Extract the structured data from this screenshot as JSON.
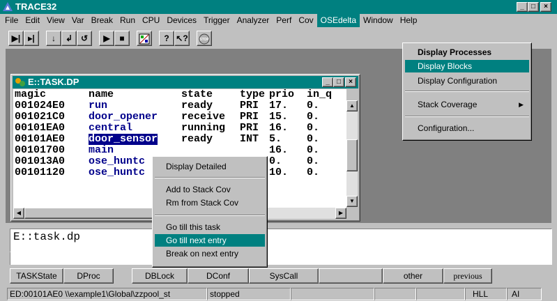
{
  "app": {
    "title": "TRACE32"
  },
  "menubar": [
    "File",
    "Edit",
    "View",
    "Var",
    "Break",
    "Run",
    "CPU",
    "Devices",
    "Trigger",
    "Analyzer",
    "Perf",
    "Cov",
    "OSEdelta",
    "Window",
    "Help"
  ],
  "toolbar_icons": [
    "step-into-icon",
    "step-over-icon",
    "step-down-icon",
    "return-icon",
    "undo-step-icon",
    "go-icon",
    "break-stop-icon",
    "mosaic-icon",
    "help-icon",
    "context-help-icon",
    "stop-icon"
  ],
  "task_window": {
    "title": "E::TASK.DP",
    "headers": {
      "magic": "magic",
      "name": "name",
      "state": "state",
      "type": "type",
      "prio": "prio",
      "inq": "in_q"
    },
    "rows": [
      {
        "magic": "001024E0",
        "name": "run",
        "state": "ready",
        "type": "PRI",
        "prio": "17.",
        "inq": "0."
      },
      {
        "magic": "001021C0",
        "name": "door_opener",
        "state": "receive",
        "type": "PRI",
        "prio": "15.",
        "inq": "0."
      },
      {
        "magic": "00101EA0",
        "name": "central",
        "state": "running",
        "type": "PRI",
        "prio": "16.",
        "inq": "0."
      },
      {
        "magic": "00101AE0",
        "name": "door_sensor",
        "state": "ready",
        "type": "INT",
        "prio": "5.",
        "inq": "0."
      },
      {
        "magic": "00101700",
        "name": "main",
        "state": "",
        "type": "",
        "prio": "16.",
        "inq": "0."
      },
      {
        "magic": "001013A0",
        "name": "ose_huntc",
        "state": "",
        "type": "",
        "prio": "0.",
        "inq": "0."
      },
      {
        "magic": "00101120",
        "name": "ose_huntc",
        "state": "",
        "type": "",
        "prio": "10.",
        "inq": "0."
      }
    ]
  },
  "context_menu": {
    "items": [
      "Display Detailed",
      "Add to Stack Cov",
      "Rm from Stack Cov",
      "Go till this task",
      "Go till next entry",
      "Break on next entry"
    ],
    "selected": "Go till next entry"
  },
  "osedelta_menu": {
    "items": [
      "Display Processes",
      "Display Blocks",
      "Display Configuration",
      "Stack Coverage",
      "Configuration..."
    ],
    "selected": "Display Blocks"
  },
  "command_line": {
    "value": "E::task.dp"
  },
  "softkeys": [
    "TASKState",
    "DProc",
    "DBLock",
    "DConf",
    "SysCall",
    "",
    "other",
    "previous"
  ],
  "statusbar": {
    "address": "ED:00101AE0  \\\\example1\\Global\\zzpool_st",
    "state": "stopped",
    "mode": "HLL",
    "extra": "AI"
  }
}
